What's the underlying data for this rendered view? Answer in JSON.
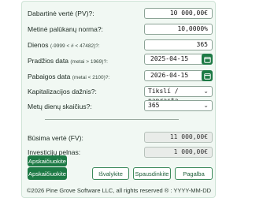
{
  "form": {
    "present_value": {
      "label": "Dabartinė vertė (PV)?:",
      "value": "10 000,00€"
    },
    "interest_rate": {
      "label": "Metinė palūkanų norma?:",
      "value": "10,0000%"
    },
    "days": {
      "label": "Dienos",
      "hint": "(-9999 < # < 47482)?:",
      "value": "365"
    },
    "start_date": {
      "label": "Pradžios data",
      "hint": "(metai > 1969)?:",
      "value": "2025-04-15"
    },
    "end_date": {
      "label": "Pabaigos data",
      "hint": "(metai < 2100)?:",
      "value": "2026-04-15"
    },
    "compounding": {
      "label": "Kapitalizacijos dažnis?:",
      "selected": "Tikslí / paprasta"
    },
    "days_per_year": {
      "label": "Metų dienų skaičius?:",
      "selected": "365"
    }
  },
  "results": {
    "future_value": {
      "label": "Būsima vertė (FV):",
      "value": "11 000,00€"
    },
    "investment_profit": {
      "label": "Investicijų pelnas:",
      "value": "1 000,00€"
    }
  },
  "buttons": {
    "calculate_small": "Apskaičiuokite",
    "calculate": "Apskaičiuokite",
    "clear": "Išvalykite",
    "print": "Spausdinkite",
    "help": "Pagalba"
  },
  "footer": {
    "text": "©2026 Pine Grove Software LLC, all rights reserved ® : YYYY-MM-DD"
  },
  "icons": {
    "calendar": "calendar-icon",
    "dropdown": "chevron-down-icon"
  },
  "colors": {
    "accent": "#1d7a45",
    "panel_bg": "#f1f8f3"
  }
}
